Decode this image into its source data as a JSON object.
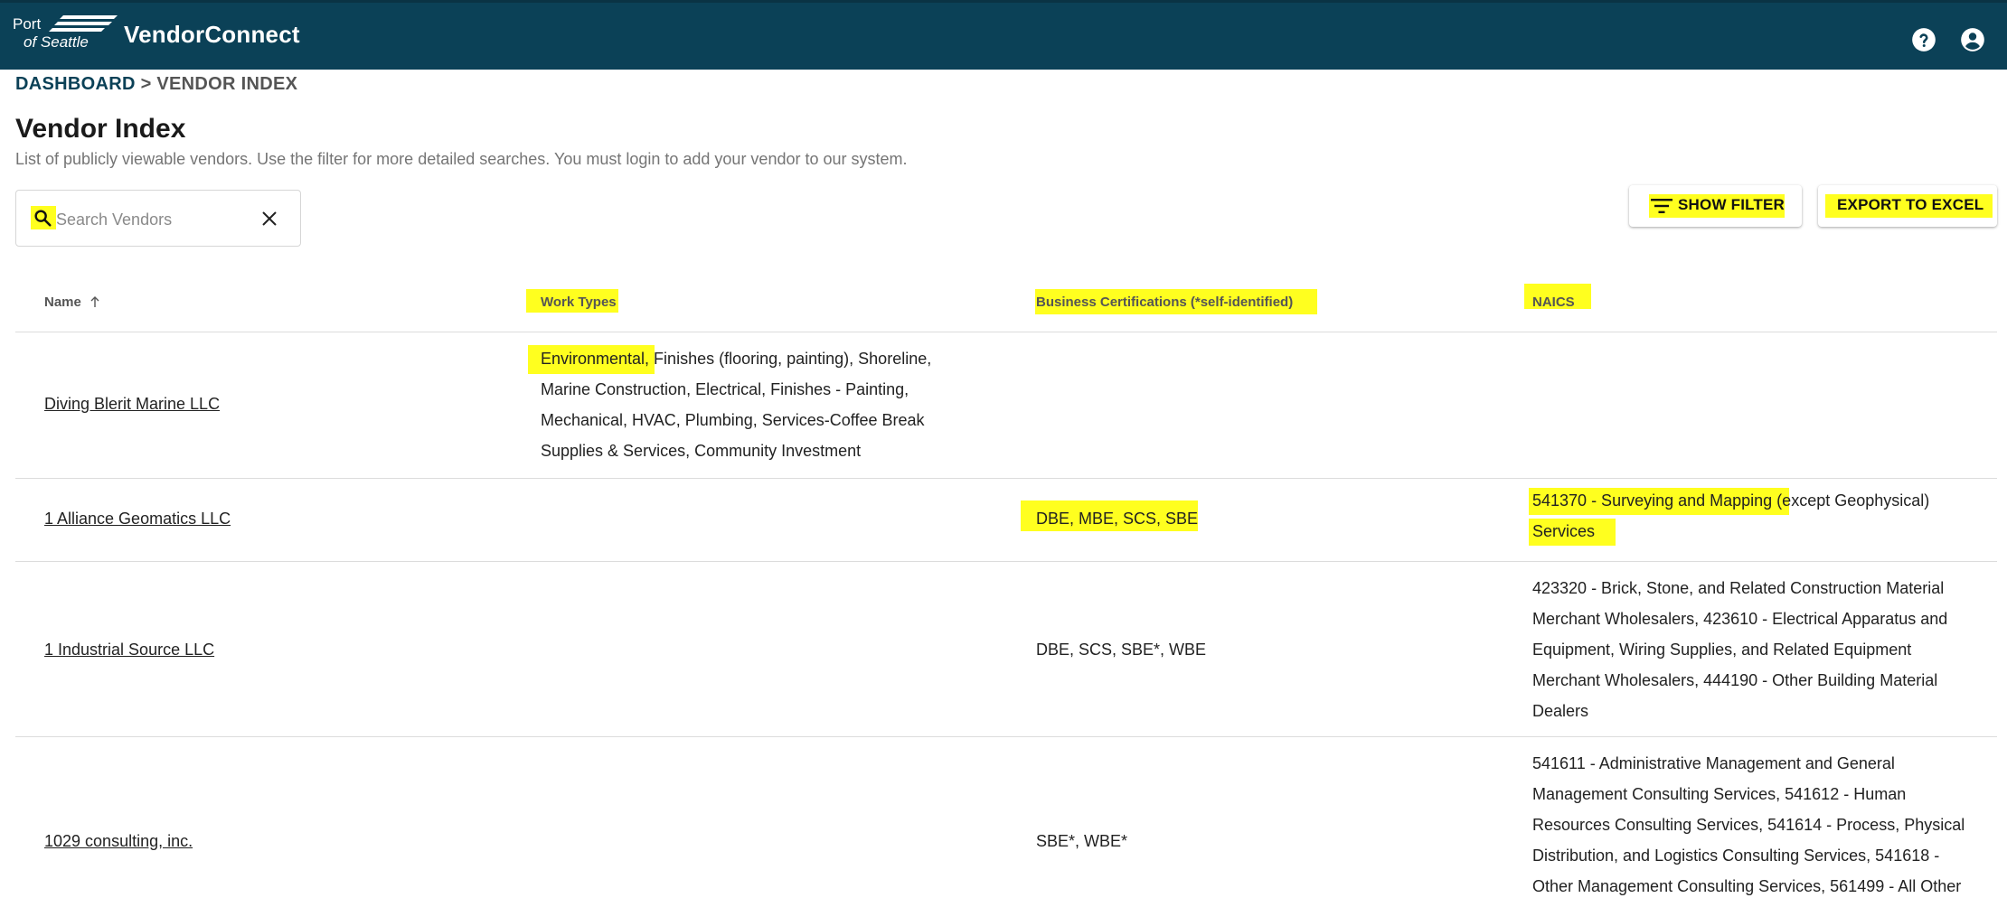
{
  "app": {
    "logo_line1": "Port",
    "logo_line2": "of Seattle",
    "brand": "VendorConnect"
  },
  "colors": {
    "appbar": "#0b4157",
    "highlight": "#ffff1f",
    "breadcrumb_link": "#0b4157"
  },
  "icons": {
    "help": "help-circle-icon",
    "account": "account-circle-icon",
    "search": "search-icon",
    "clear": "close-icon",
    "filter": "filter-list-icon",
    "sort": "arrow-up-icon"
  },
  "breadcrumb": {
    "root": "DASHBOARD",
    "separator": ">",
    "current": "VENDOR INDEX"
  },
  "page": {
    "title": "Vendor Index",
    "subtitle": "List of publicly viewable vendors. Use the filter for more detailed searches. You must login to add your vendor to our system."
  },
  "search": {
    "placeholder": "Search Vendors",
    "value": ""
  },
  "buttons": {
    "show_filter": "SHOW FILTER",
    "export": "EXPORT TO EXCEL"
  },
  "table": {
    "headers": {
      "name": "Name",
      "work_types": "Work Types",
      "certifications": "Business Certifications (*self-identified)",
      "naics": "NAICS"
    },
    "rows": [
      {
        "name": "Diving Blerit Marine LLC",
        "work_lines": [
          "Environmental, Finishes (flooring, painting), Shoreline,",
          "Marine Construction, Electrical, Finishes - Painting,",
          "Mechanical, HVAC, Plumbing, Services-Coffee Break",
          "Supplies & Services, Community Investment"
        ],
        "certifications": "",
        "naics_lines": []
      },
      {
        "name": "1 Alliance Geomatics LLC",
        "work_lines": [],
        "certifications": "DBE, MBE, SCS, SBE",
        "naics_lines": [
          "541370 - Surveying and Mapping (except Geophysical)",
          "Services"
        ]
      },
      {
        "name": "1 Industrial Source LLC",
        "work_lines": [],
        "certifications": "DBE, SCS, SBE*, WBE",
        "naics_lines": [
          "423320 - Brick, Stone, and Related Construction Material",
          "Merchant Wholesalers, 423610 - Electrical Apparatus and",
          "Equipment, Wiring Supplies, and Related Equipment",
          "Merchant Wholesalers, 444190 - Other Building Material",
          "Dealers"
        ]
      },
      {
        "name": "1029 consulting, inc.",
        "work_lines": [],
        "certifications": "SBE*, WBE*",
        "naics_lines": [
          "541611 - Administrative Management and General",
          "Management Consulting Services, 541612 - Human",
          "Resources Consulting Services, 541614 - Process, Physical",
          "Distribution, and Logistics Consulting Services, 541618 -",
          "Other Management Consulting Services, 561499 - All Other"
        ]
      }
    ]
  }
}
